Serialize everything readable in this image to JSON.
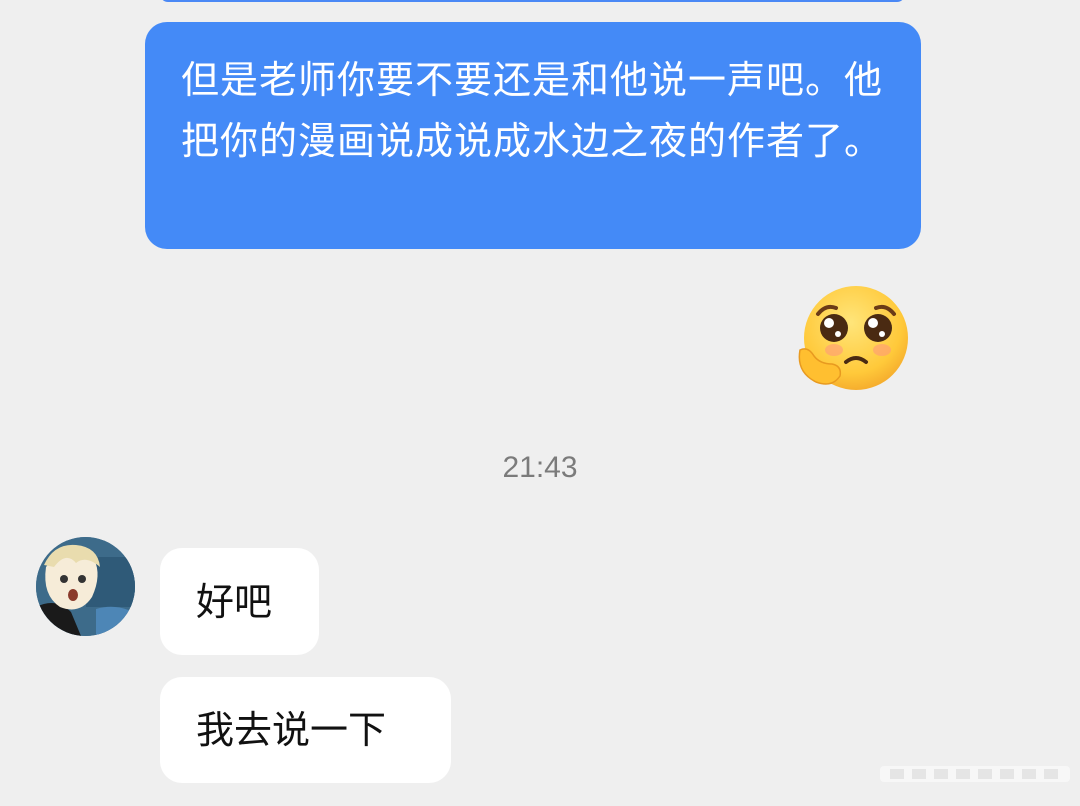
{
  "messages": {
    "outgoing_text": "但是老师你要不要还是和他说一声吧。他把你的漫画说成说成水边之夜的作者了。",
    "outgoing_emoji": "pleading-face-emoji",
    "timestamp": "21:43",
    "incoming": [
      {
        "text": "好吧"
      },
      {
        "text": "我去说一下"
      }
    ]
  },
  "colors": {
    "outgoing_bubble": "#448af7",
    "incoming_bubble": "#ffffff",
    "background": "#efefef"
  }
}
